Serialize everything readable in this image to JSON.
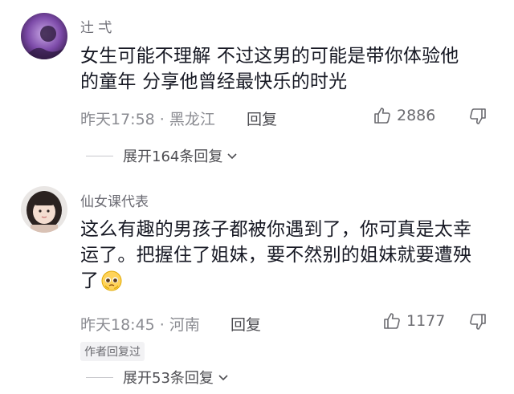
{
  "comments": [
    {
      "username": "辻 弌",
      "text_line1": "女生可能不理解   不过这男的可能是带你体验他",
      "text_line2": "的童年  分享他曾经最快乐的时光",
      "time": "昨天17:58",
      "location": "黑龙江",
      "reply_label": "回复",
      "likes": "2886",
      "expand_label": "展开164条回复"
    },
    {
      "username": "仙女课代表",
      "text_line1": "这么有趣的男孩子都被你遇到了，你可真是太幸",
      "text_line2": "运了。把握住了姐妹，要不然别的姐妹就要遭殃",
      "text_line3": "了",
      "time": "昨天18:45",
      "location": "河南",
      "reply_label": "回复",
      "likes": "1177",
      "author_badge": "作者回复过",
      "expand_label": "展开53条回复"
    }
  ],
  "icons": {
    "like": "thumbs-up-icon",
    "dislike": "thumbs-down-icon",
    "expand": "chevron-down-icon",
    "emoji": "pleading-face-emoji"
  }
}
